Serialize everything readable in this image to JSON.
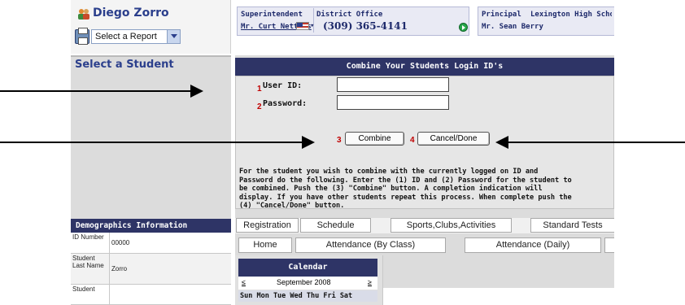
{
  "user": {
    "name": "Diego Zorro",
    "report_select": "Select a Report"
  },
  "contacts": {
    "superintendent_label": "Superintendent",
    "superintendent_name": "Mr. Curt Nettles",
    "district_label": "District Office",
    "district_phone": "(309) 365-4141",
    "principal_label": "Principal",
    "principal_name": "Mr. Sean Berry",
    "school_label": "Lexington High Scho"
  },
  "left_panel": {
    "title": "Select a Student"
  },
  "dialog": {
    "title": "Combine Your Students Login ID's",
    "fields": [
      {
        "num": "1",
        "label": "User ID:",
        "value": ""
      },
      {
        "num": "2",
        "label": "Password:",
        "value": ""
      }
    ],
    "buttons": [
      {
        "num": "3",
        "label": "Combine"
      },
      {
        "num": "4",
        "label": "Cancel/Done"
      }
    ],
    "instructions": [
      "For the student you wish to combine with the currently logged on ID and",
      "Password do the following. Enter the (1) ID and (2) Password for the student to",
      "be combined. Push the (3) \"Combine\" button. A completion indication will",
      "display. If you have other students repeat this process. When complete push the",
      "(4) \"Cancel/Done\" button."
    ]
  },
  "demographics": {
    "title": "Demographics Information",
    "rows": [
      {
        "label": "ID Number",
        "value": "00000"
      },
      {
        "label": "Student Last Name",
        "value": "Zorro"
      },
      {
        "label": "Student",
        "value": ""
      }
    ]
  },
  "tabs_row1": [
    "Registration",
    "Schedule",
    "Sports,Clubs,Activities",
    "Standard Tests"
  ],
  "tabs_row2": [
    "Home",
    "Attendance (By Class)",
    "Attendance (Daily)"
  ],
  "calendar": {
    "title": "Calendar",
    "prev": "≤",
    "month": "September 2008",
    "next": "≥",
    "days": "Sun Mon Tue Wed Thu Fri Sat"
  }
}
